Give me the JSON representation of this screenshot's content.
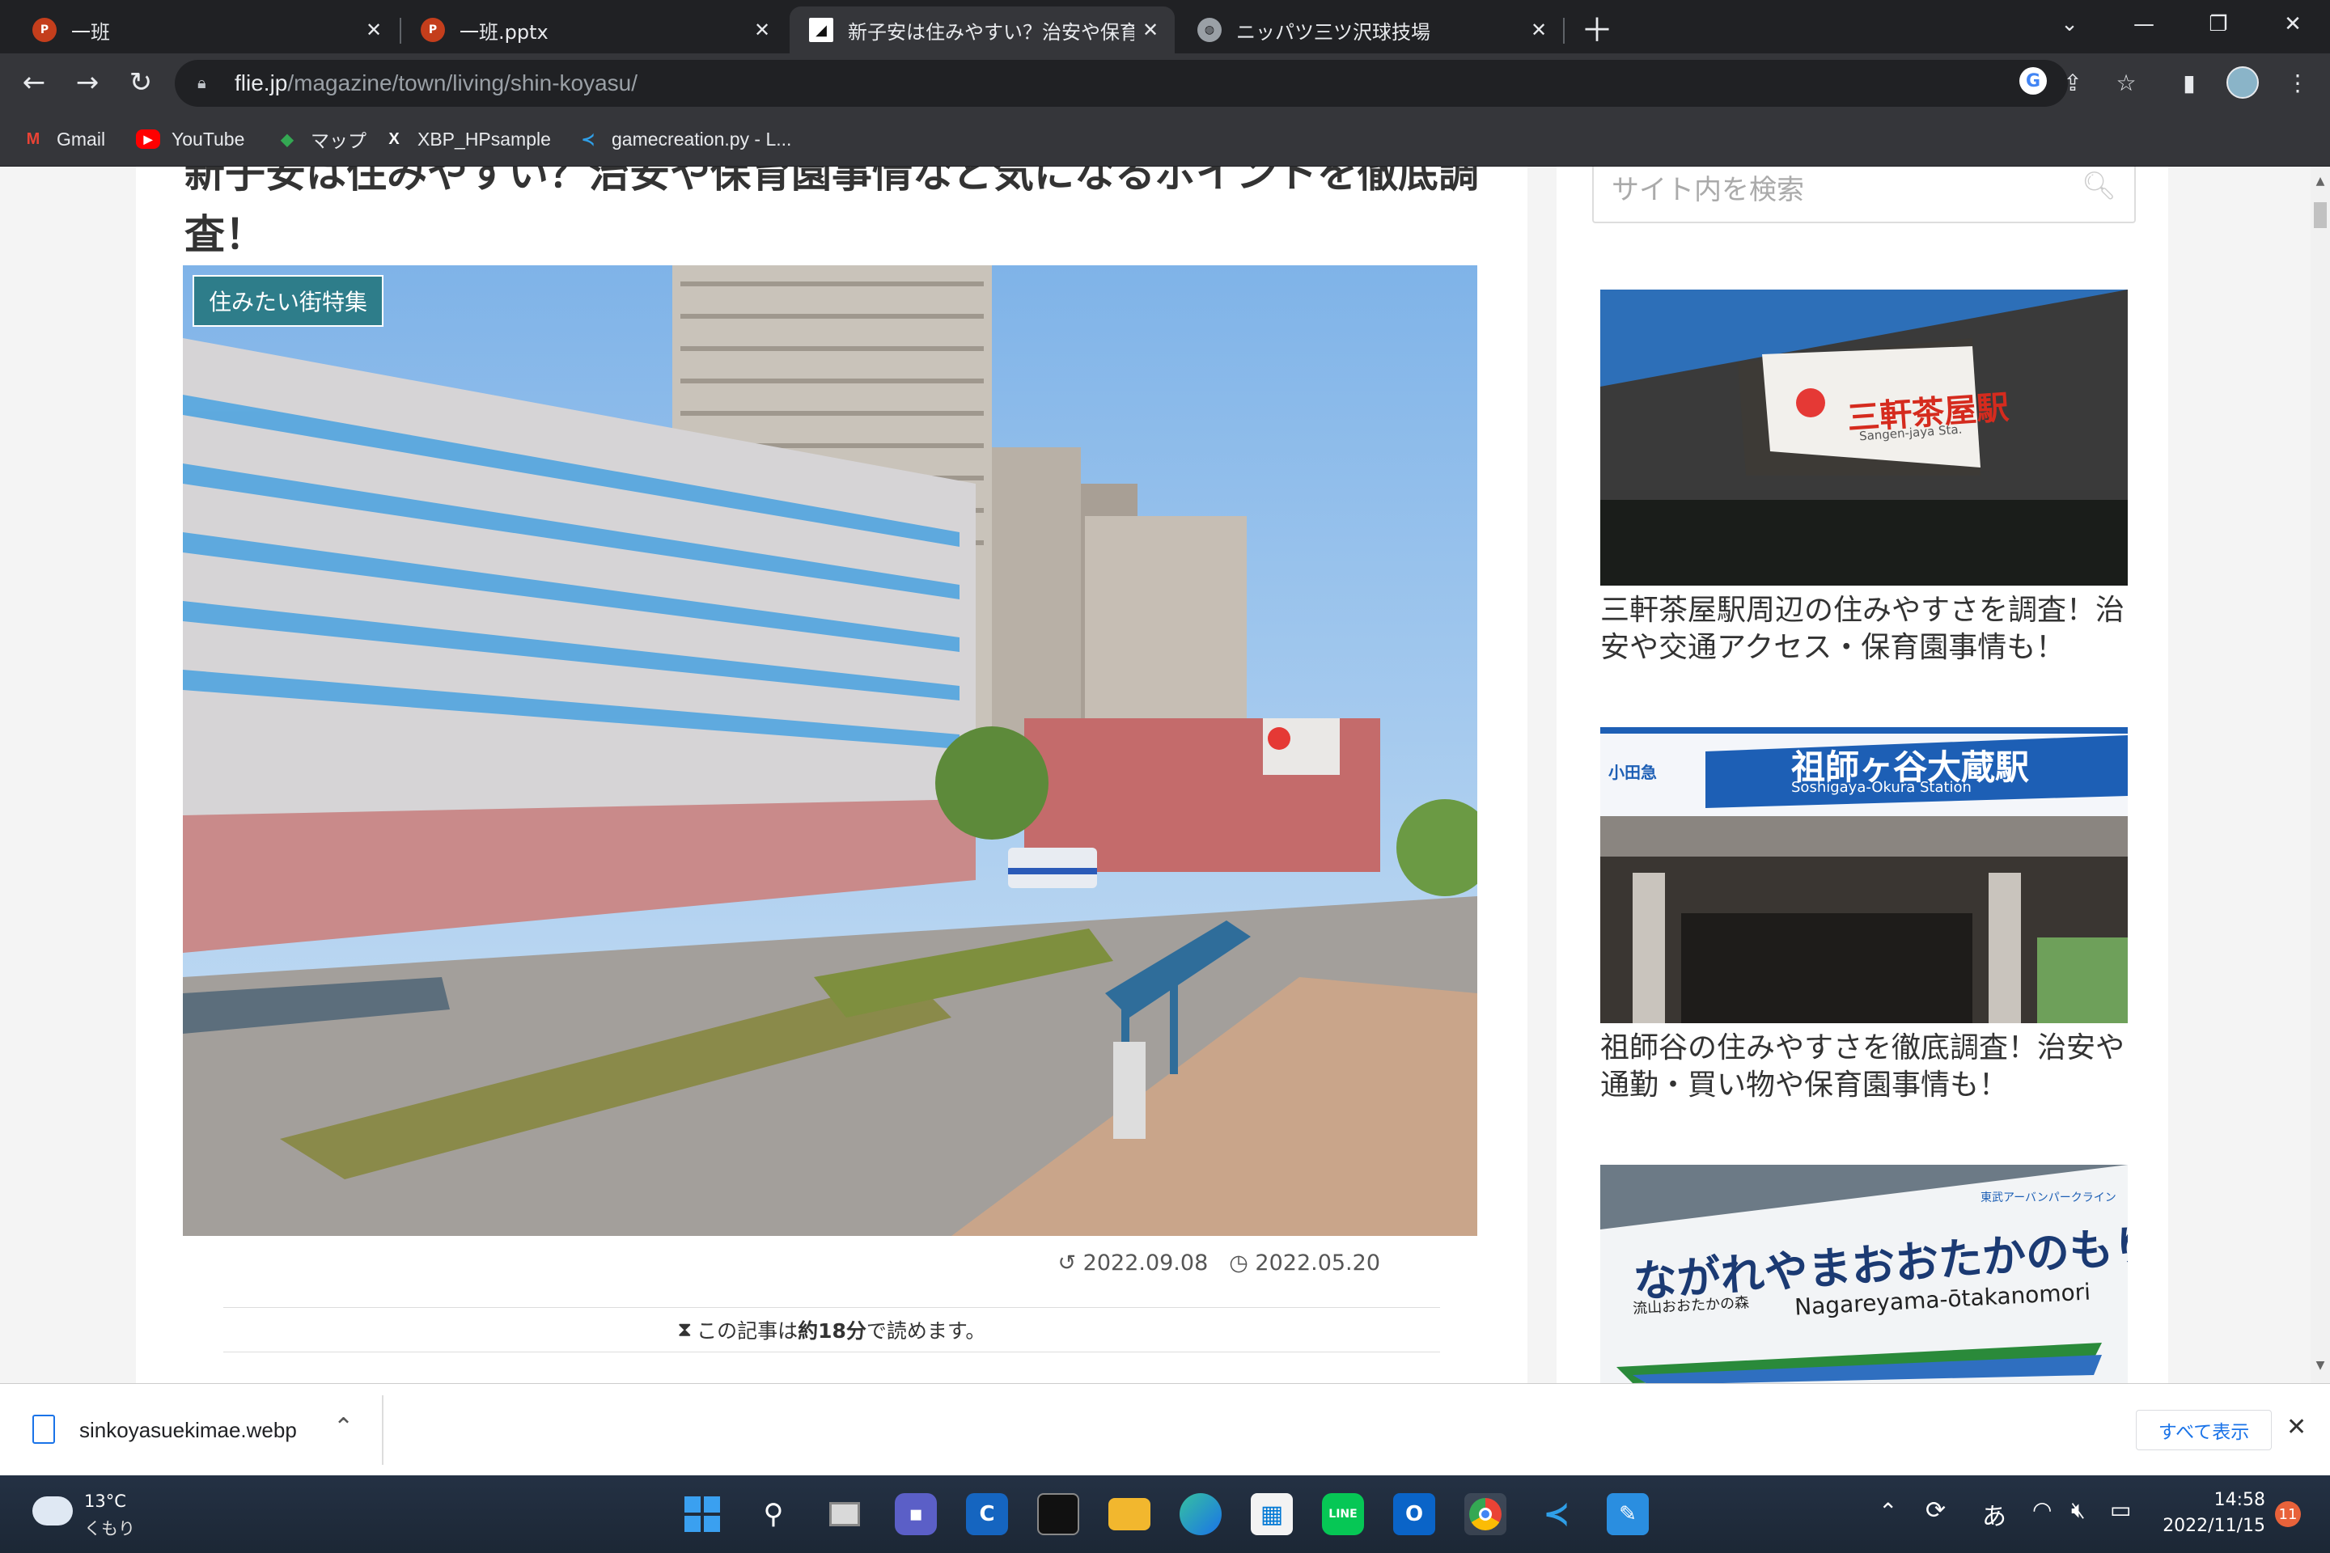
{
  "tabs": [
    {
      "title": "一班",
      "icon": "powerpoint-icon"
    },
    {
      "title": "一班.pptx",
      "icon": "powerpoint-icon"
    },
    {
      "title": "新子安は住みやすい？治安や保育園",
      "icon": "flie-site-icon",
      "active": true
    },
    {
      "title": "ニッパツ三ツ沢球技場",
      "icon": "globe-icon"
    }
  ],
  "toolbar": {
    "url_host": "flie.jp",
    "url_path": "/magazine/town/living/shin-koyasu/"
  },
  "bookmarks": [
    {
      "label": "Gmail",
      "icon": "gmail-icon"
    },
    {
      "label": "YouTube",
      "icon": "youtube-icon"
    },
    {
      "label": "マップ",
      "icon": "maps-icon"
    },
    {
      "label": "XBP_HPsample",
      "icon": "x-icon"
    },
    {
      "label": "gamecreation.py - L...",
      "icon": "vscode-icon"
    }
  ],
  "article": {
    "headline": "新子安は住みやすい？治安や保育園事情など気になるポイントを徹底調査！",
    "category": "住みたい街特集",
    "updated": "2022.09.08",
    "published": "2022.05.20",
    "readtime_prefix": "この記事は",
    "readtime_value": "約18分",
    "readtime_suffix": "で読めます。"
  },
  "sidebar": {
    "search_placeholder": "サイト内を検索",
    "cards": [
      {
        "title": "三軒茶屋駅周辺の住みやすさを調査！治安や交通アクセス・保育園事情も！",
        "sign_jp": "三軒茶屋駅",
        "sign_en": "Sangen-jaya Sta."
      },
      {
        "title": "祖師谷の住みやすさを徹底調査！治安や通勤・買い物や保育園事情も！",
        "sign_jp": "祖師ヶ谷大蔵駅",
        "sign_en": "Soshigaya-Okura Station",
        "sign_line": "小田急"
      },
      {
        "title": "",
        "sign_jp": "ながれやまおおたかのもり",
        "sign_en": "Nagareyama-ōtakanomori",
        "sign_sub": "流山おおたかの森",
        "sign_top": "東武アーバンパークライン"
      }
    ]
  },
  "download": {
    "filename": "sinkoyasuekimae.webp",
    "show_all": "すべて表示"
  },
  "taskbar": {
    "temp": "13°C",
    "weather": "くもり",
    "time": "14:58",
    "date": "2022/11/15",
    "notifications": "11",
    "ime": "あ"
  },
  "colors": {
    "accent": "#2e7d8a",
    "chrome_dark": "#202124",
    "chrome_toolbar": "#35363a"
  }
}
